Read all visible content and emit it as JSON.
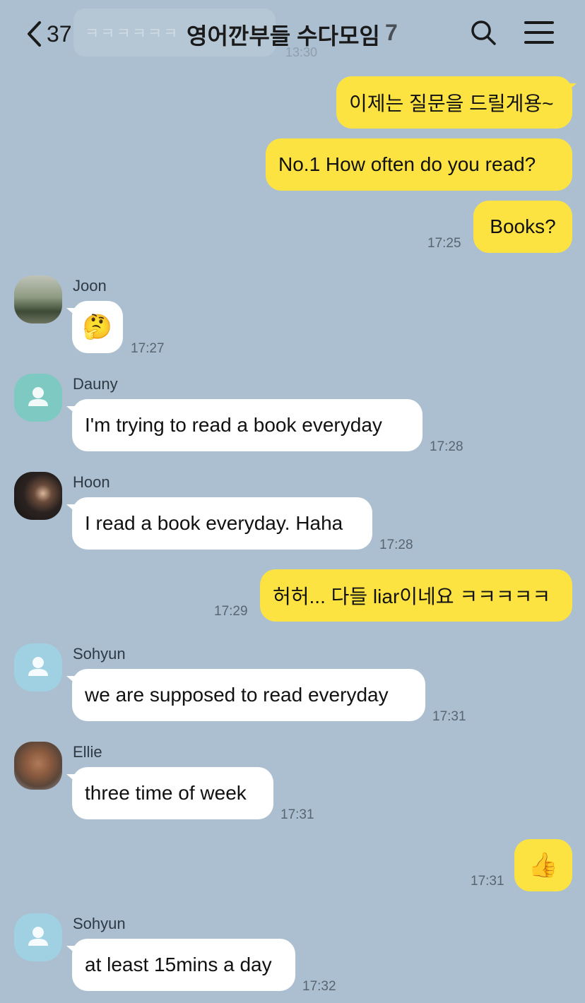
{
  "header": {
    "back_count": "37",
    "title": "영어깐부들 수다모임",
    "member_count": "7",
    "ghost_text": "ㅋㅋㅋㅋㅋㅋ",
    "ghost_time": "13:30"
  },
  "messages": [
    {
      "from": "me",
      "text": "이제는 질문을 드릴게용~"
    },
    {
      "from": "me",
      "text": "No.1 How often do you read?"
    },
    {
      "from": "me",
      "text": "Books?",
      "time": "17:25"
    },
    {
      "from": "them",
      "sender": "Joon",
      "text": "🤔",
      "time": "17:27"
    },
    {
      "from": "them",
      "sender": "Dauny",
      "text": "I'm trying to read a book everyday",
      "time": "17:28"
    },
    {
      "from": "them",
      "sender": "Hoon",
      "text": "I read a book everyday. Haha",
      "time": "17:28"
    },
    {
      "from": "me",
      "text": "허허... 다들 liar이네요 ㅋㅋㅋㅋㅋ",
      "time": "17:29"
    },
    {
      "from": "them",
      "sender": "Sohyun",
      "text": "we are supposed to read everyday",
      "time": "17:31"
    },
    {
      "from": "them",
      "sender": "Ellie",
      "text": "three time of week",
      "time": "17:31"
    },
    {
      "from": "me",
      "text": "👍",
      "time": "17:31"
    },
    {
      "from": "them",
      "sender": "Sohyun",
      "text": "at least 15mins a day",
      "time": "17:32"
    }
  ],
  "colors": {
    "background": "#abbfd0",
    "my_bubble": "#fde342",
    "their_bubble": "#ffffff"
  }
}
